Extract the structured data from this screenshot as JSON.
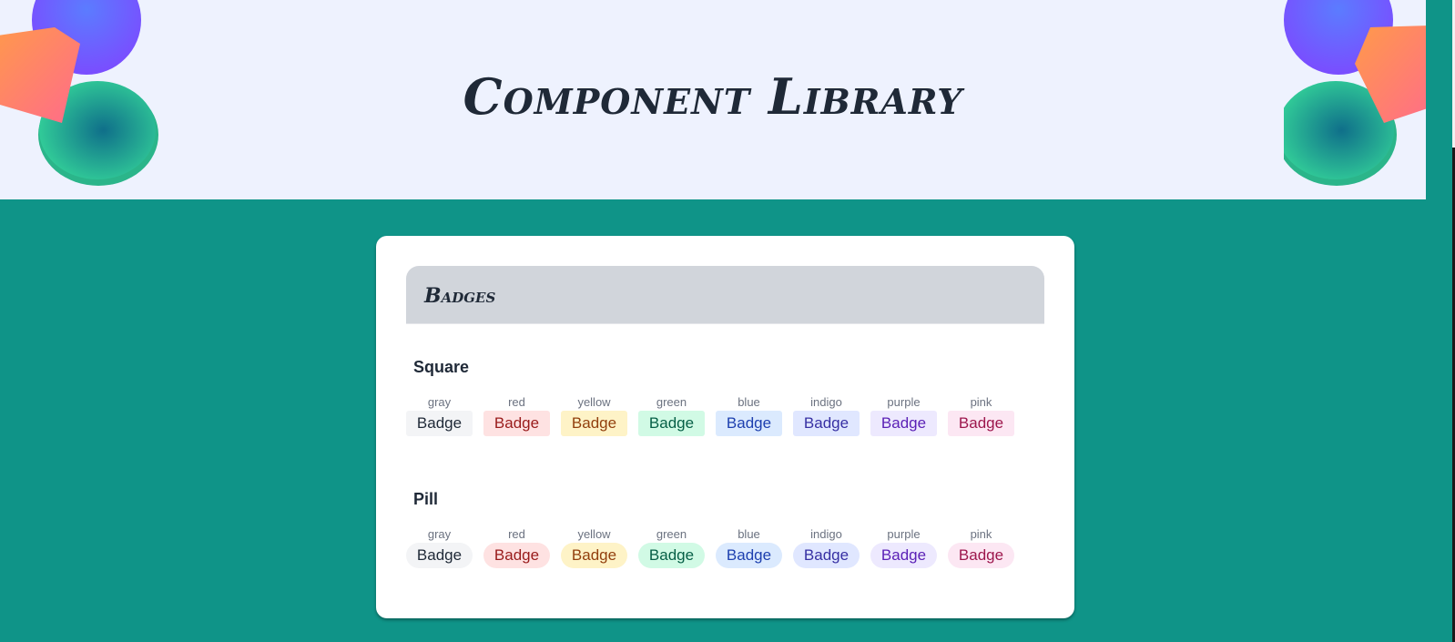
{
  "page": {
    "title": "Component Library"
  },
  "card": {
    "title": "Badges"
  },
  "sections": [
    {
      "title": "Square",
      "style": "square",
      "badges": [
        {
          "color": "gray",
          "label": "Badge",
          "bg": "#f3f4f6",
          "fg": "#1f2937"
        },
        {
          "color": "red",
          "label": "Badge",
          "bg": "#fee2e2",
          "fg": "#991b1b"
        },
        {
          "color": "yellow",
          "label": "Badge",
          "bg": "#fef3c7",
          "fg": "#92400e"
        },
        {
          "color": "green",
          "label": "Badge",
          "bg": "#d1fae5",
          "fg": "#065f46"
        },
        {
          "color": "blue",
          "label": "Badge",
          "bg": "#dbeafe",
          "fg": "#1e40af"
        },
        {
          "color": "indigo",
          "label": "Badge",
          "bg": "#e0e7ff",
          "fg": "#3730a3"
        },
        {
          "color": "purple",
          "label": "Badge",
          "bg": "#ede9fe",
          "fg": "#5b21b6"
        },
        {
          "color": "pink",
          "label": "Badge",
          "bg": "#fce7f3",
          "fg": "#9d174d"
        }
      ]
    },
    {
      "title": "Pill",
      "style": "pill",
      "badges": [
        {
          "color": "gray",
          "label": "Badge",
          "bg": "#f3f4f6",
          "fg": "#1f2937"
        },
        {
          "color": "red",
          "label": "Badge",
          "bg": "#fee2e2",
          "fg": "#991b1b"
        },
        {
          "color": "yellow",
          "label": "Badge",
          "bg": "#fef3c7",
          "fg": "#92400e"
        },
        {
          "color": "green",
          "label": "Badge",
          "bg": "#d1fae5",
          "fg": "#065f46"
        },
        {
          "color": "blue",
          "label": "Badge",
          "bg": "#dbeafe",
          "fg": "#1e40af"
        },
        {
          "color": "indigo",
          "label": "Badge",
          "bg": "#e0e7ff",
          "fg": "#3730a3"
        },
        {
          "color": "purple",
          "label": "Badge",
          "bg": "#ede9fe",
          "fg": "#5b21b6"
        },
        {
          "color": "pink",
          "label": "Badge",
          "bg": "#fce7f3",
          "fg": "#9d174d"
        }
      ]
    }
  ],
  "colors": {
    "background": "#0f9488",
    "banner": "#eef2fe",
    "card_header": "#d1d5db",
    "text_dark": "#1f2937"
  }
}
